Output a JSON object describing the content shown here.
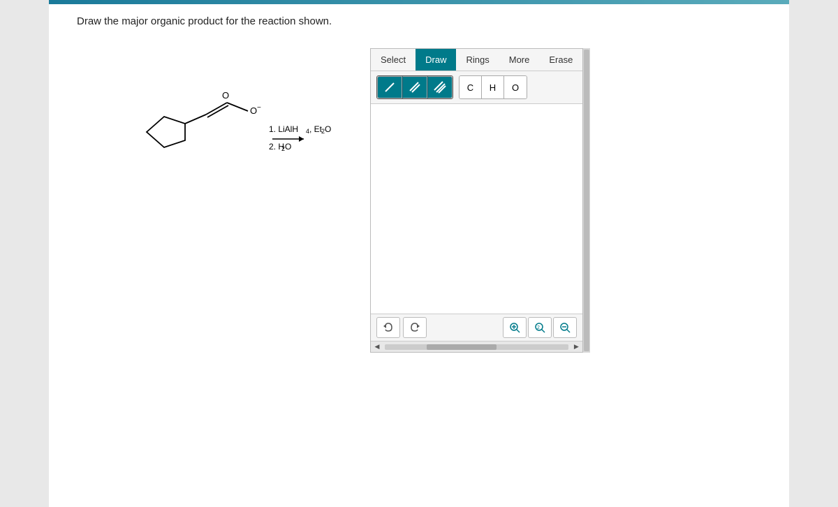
{
  "page": {
    "question": "Draw the major organic product for the reaction shown."
  },
  "toolbar": {
    "select_label": "Select",
    "draw_label": "Draw",
    "rings_label": "Rings",
    "more_label": "More",
    "erase_label": "Erase"
  },
  "bonds": {
    "single": "/",
    "double": "//",
    "triple": "///"
  },
  "atoms": {
    "carbon": "C",
    "hydrogen": "H",
    "oxygen": "O"
  },
  "bottom_controls": {
    "undo_icon": "undo-icon",
    "redo_icon": "redo-icon",
    "zoom_in_icon": "zoom-in-icon",
    "zoom_fit_icon": "zoom-fit-icon",
    "zoom_out_icon": "zoom-out-icon"
  },
  "reaction": {
    "step1": "1. LiAlH",
    "step1_sub": "4",
    "step1_solvent": ", Et",
    "step1_solvent_sub": "2",
    "step1_solvent_end": "O",
    "step2": "2. H",
    "step2_sub": "2",
    "step2_end": "O"
  }
}
